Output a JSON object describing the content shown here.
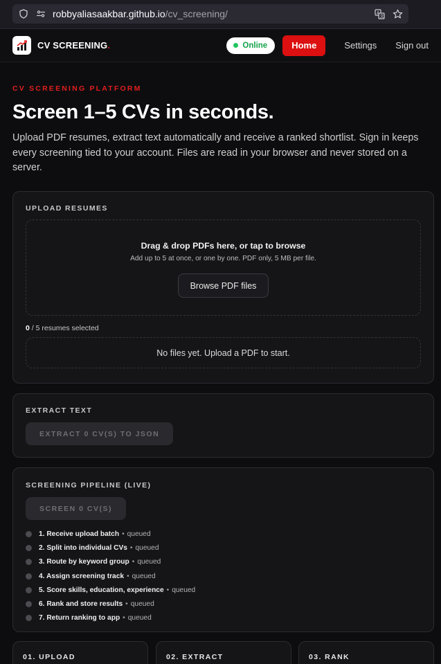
{
  "browser": {
    "url_host": "robbyaliasaakbar.github.io",
    "url_path": "/cv_screening/"
  },
  "nav": {
    "brand": "CV SCREENING",
    "brand_dot": ".",
    "status": "Online",
    "home": "Home",
    "settings": "Settings",
    "signout": "Sign out"
  },
  "hero": {
    "eyebrow": "CV SCREENING PLATFORM",
    "title": "Screen 1–5 CVs in seconds.",
    "description": "Upload PDF resumes, extract text automatically and receive a ranked shortlist. Sign in keeps every screening tied to your account. Files are read in your browser and never stored on a server."
  },
  "upload": {
    "title": "UPLOAD RESUMES",
    "drop_title": "Drag & drop PDFs here, or tap to browse",
    "drop_sub": "Add up to 5 at once, or one by one. PDF only, 5 MB per file.",
    "browse": "Browse PDF files",
    "count_selected": "0",
    "count_rest": " / 5 resumes selected",
    "empty": "No files yet. Upload a PDF to start."
  },
  "extract": {
    "title": "EXTRACT TEXT",
    "button": "EXTRACT 0 CV(S) TO JSON"
  },
  "pipeline": {
    "title": "SCREENING PIPELINE (LIVE)",
    "button": "SCREEN 0 CV(S)",
    "separator": "•",
    "steps": [
      {
        "label": "1. Receive upload batch",
        "status": "queued"
      },
      {
        "label": "2. Split into individual CVs",
        "status": "queued"
      },
      {
        "label": "3. Route by keyword group",
        "status": "queued"
      },
      {
        "label": "4. Assign screening track",
        "status": "queued"
      },
      {
        "label": "5. Score skills, education, experience",
        "status": "queued"
      },
      {
        "label": "6. Rank and store results",
        "status": "queued"
      },
      {
        "label": "7. Return ranking to app",
        "status": "queued"
      }
    ]
  },
  "bottom_cards": [
    "01. UPLOAD",
    "02. EXTRACT",
    "03. RANK"
  ]
}
